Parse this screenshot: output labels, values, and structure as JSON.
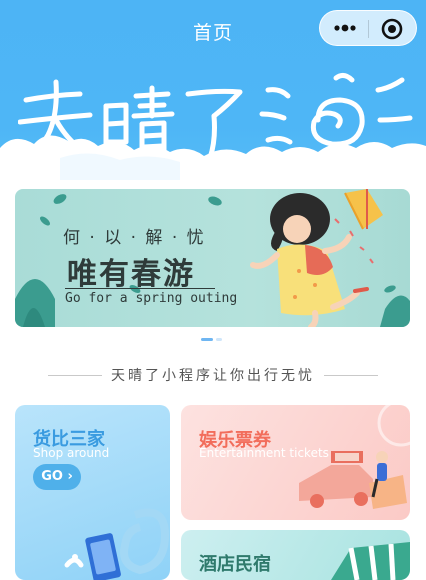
{
  "header": {
    "title": "首页",
    "background": "#4eb6f6",
    "capsule": {
      "more_icon": "more-dots-icon",
      "close_icon": "target-circle-icon"
    },
    "brand_text": "天晴了"
  },
  "banner": {
    "subtitle": "何 · 以 · 解 · 忧",
    "title": "唯有春游",
    "english": "Go for a spring outing",
    "pagination": {
      "count": 2,
      "active_index": 0
    }
  },
  "slogan": "天晴了小程序让你出行无忧",
  "cards": {
    "shop": {
      "title": "货比三家",
      "subtitle": "Shop around",
      "button": "GO",
      "color": "#3a9be0"
    },
    "entertainment": {
      "title": "娱乐票券",
      "subtitle": "Entertainment tickets",
      "color": "#f26d5b"
    },
    "hotel": {
      "title": "酒店民宿",
      "color": "#2f7a6c"
    }
  }
}
